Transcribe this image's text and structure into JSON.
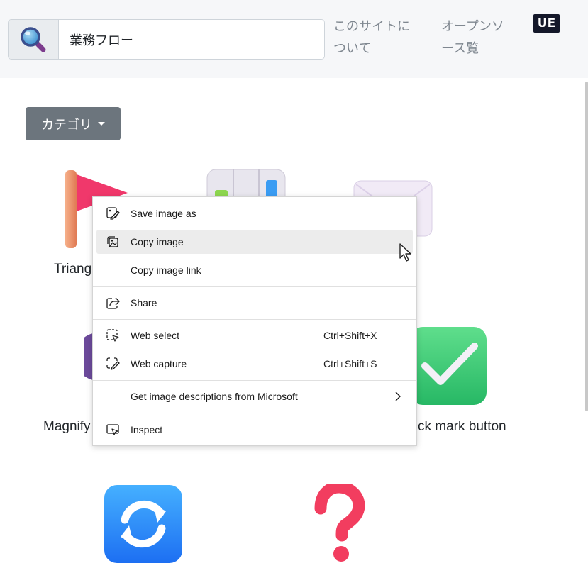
{
  "header": {
    "search": {
      "value": "業務フロー",
      "placeholder": ""
    },
    "nav": {
      "about": "このサイトに\nついて",
      "oss": "オープンソ\nース覧"
    },
    "badge": "UE"
  },
  "category_button": {
    "label": "カテゴリ"
  },
  "emojis": {
    "triangular_flag": {
      "label": "Triang",
      "icon": "triangular-flag-icon"
    },
    "bar_chart": {
      "label": "",
      "icon": "bar-chart-icon"
    },
    "envelope": {
      "label": "",
      "icon": "envelope-icon"
    },
    "magnifying_glass": {
      "label": "Magnify",
      "icon": "magnifying-glass-icon"
    },
    "check_mark_button": {
      "label": "ck mark button",
      "icon": "check-mark-button-icon"
    },
    "repeat_button": {
      "label": "",
      "icon": "counterclockwise-arrows-icon"
    },
    "question_mark": {
      "label": "",
      "icon": "red-question-mark-icon"
    }
  },
  "context_menu": {
    "save_image_as": "Save image as",
    "copy_image": "Copy image",
    "copy_image_link": "Copy image link",
    "share": "Share",
    "web_select": {
      "label": "Web select",
      "shortcut": "Ctrl+Shift+X"
    },
    "web_capture": {
      "label": "Web capture",
      "shortcut": "Ctrl+Shift+S"
    },
    "image_descriptions": "Get image descriptions from Microsoft",
    "inspect": "Inspect"
  },
  "colors": {
    "header_bg": "#f6f7f9",
    "category_button_bg": "#6c757d",
    "badge_bg": "#14182a",
    "menu_hover_bg": "#ececec"
  }
}
